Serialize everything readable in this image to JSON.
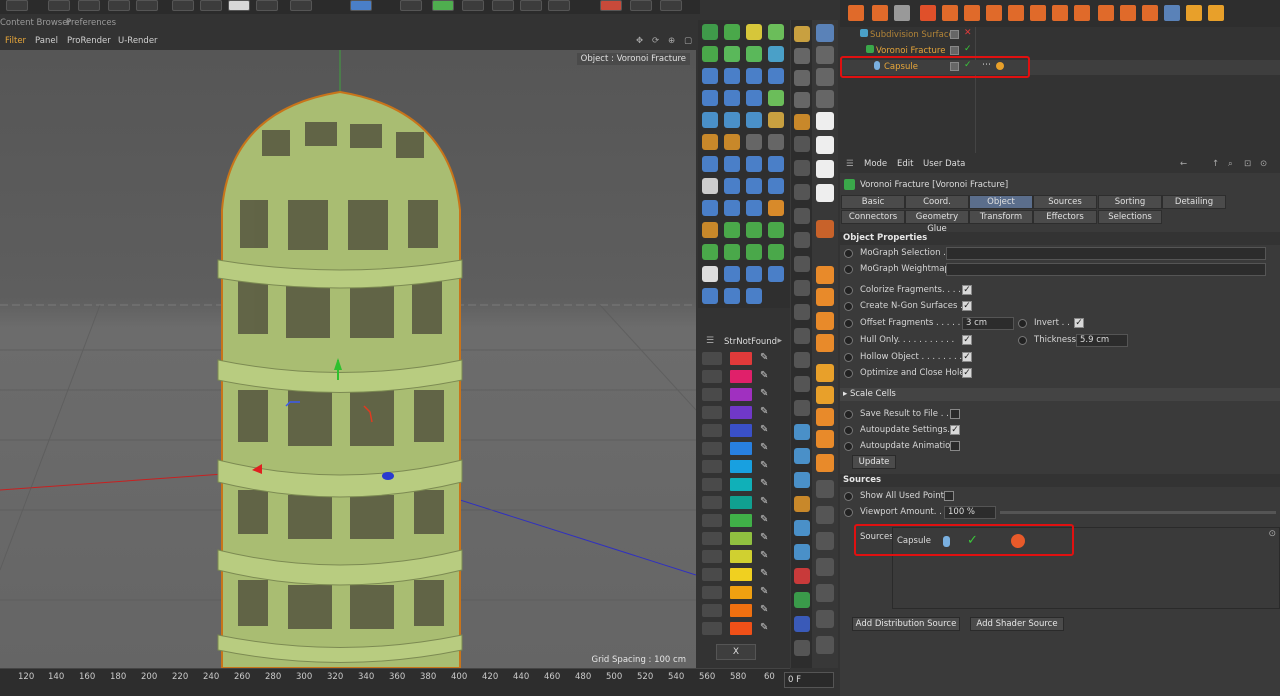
{
  "menus": {
    "top": [
      "Content Browser",
      "Preferences"
    ],
    "viewport": [
      "Filter",
      "Panel",
      "ProRender",
      "U-Render"
    ]
  },
  "viewport": {
    "label": "Object : Voronoi Fracture",
    "grid_spacing": "Grid Spacing : 100 cm"
  },
  "ruler": {
    "ticks": [
      "120",
      "140",
      "160",
      "180",
      "200",
      "220",
      "240",
      "260",
      "280",
      "300",
      "320",
      "340",
      "360",
      "380",
      "400",
      "420",
      "440",
      "460",
      "480",
      "500",
      "520",
      "540",
      "560",
      "580",
      "60"
    ],
    "frame": "0 F"
  },
  "swatch_panel": {
    "title": "StrNotFound",
    "colors": [
      "#e03a3a",
      "#e0206a",
      "#a030c0",
      "#7038c8",
      "#3a50c8",
      "#2880e0",
      "#18a0e0",
      "#10b0b8",
      "#10a090",
      "#40b048",
      "#90c040",
      "#d0d030",
      "#f0d020",
      "#f0a010",
      "#f07010",
      "#f05018"
    ],
    "close_label": "X"
  },
  "object_manager": {
    "objects": [
      {
        "name": "Subdivision Surface"
      },
      {
        "name": "Voronoi Fracture"
      },
      {
        "name": "Capsule"
      }
    ]
  },
  "attribute_manager": {
    "menu": [
      "Mode",
      "Edit",
      "User Data"
    ],
    "title": "Voronoi Fracture [Voronoi Fracture]",
    "tabs_row1": [
      "Basic",
      "Coord.",
      "Object",
      "Sources",
      "Sorting",
      "Detailing"
    ],
    "tabs_row2": [
      "Connectors",
      "Geometry Glue",
      "Transform",
      "Effectors",
      "Selections"
    ],
    "active_tab": "Object",
    "sections": {
      "object_properties": "Object Properties",
      "scale_cells": "Scale Cells",
      "sources": "Sources"
    },
    "props": {
      "mograph_selection": "MoGraph Selection . .",
      "mograph_weightmap": "MoGraph Weightmap",
      "colorize": "Colorize Fragments. . . .",
      "ngon": "Create N-Gon Surfaces . .",
      "offset": "Offset Fragments . . . . . .",
      "offset_value": "3 cm",
      "invert": "Invert . .",
      "hull": "Hull Only. . . . . . . . . . .",
      "thickness": "Thickness",
      "thickness_value": "5.9 cm",
      "hollow": "Hollow Object . . . . . . . .",
      "optimize": "Optimize and Close Holes",
      "save_result": "Save Result to File . .",
      "autoupdate_settings": "Autoupdate Settings. .",
      "autoupdate_animation": "Autoupdate Animation",
      "update_button": "Update",
      "show_all": "Show All Used Points",
      "viewport_amount": "Viewport Amount. .",
      "viewport_amount_value": "100 %",
      "sources_label": "Sources",
      "source_item": "Capsule",
      "check_mark": "✓",
      "add_distribution": "Add Distribution Source",
      "add_shader": "Add Shader Source"
    }
  }
}
